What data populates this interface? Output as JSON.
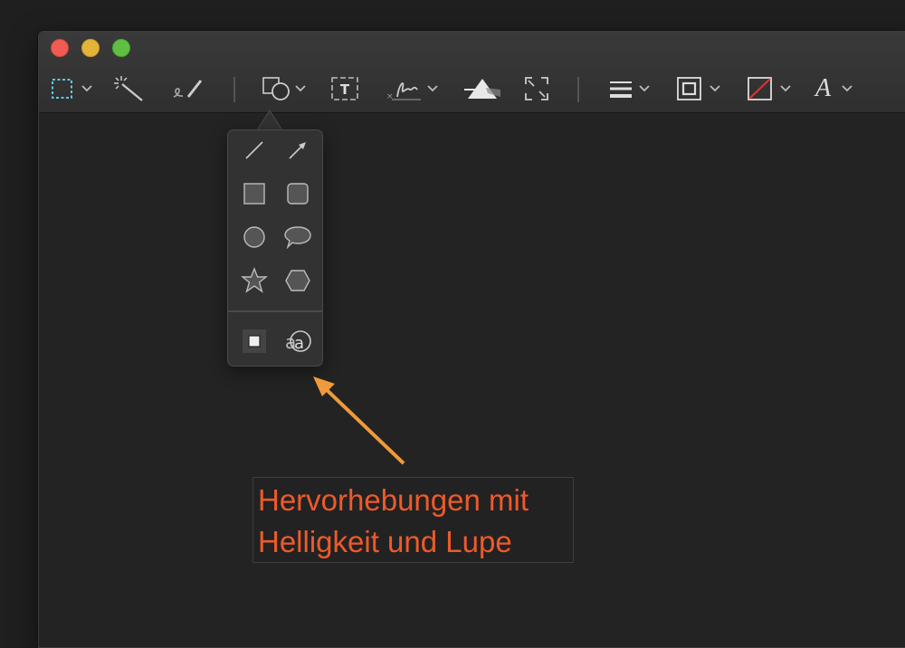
{
  "window": {
    "traffic_lights": [
      "close",
      "minimize",
      "zoom"
    ]
  },
  "toolbar": {
    "tools": [
      {
        "name": "selection-tools",
        "icon": "dashed-rect-icon",
        "has_menu": true
      },
      {
        "name": "instant-alpha",
        "icon": "magic-wand-icon",
        "has_menu": false
      },
      {
        "name": "sketch",
        "icon": "pen-scribble-icon",
        "has_menu": false
      },
      {
        "name": "shapes",
        "icon": "shapes-icon",
        "has_menu": true,
        "active": true
      },
      {
        "name": "text",
        "icon": "text-box-icon",
        "has_menu": false
      },
      {
        "name": "sign",
        "icon": "signature-icon",
        "has_menu": true
      },
      {
        "name": "adjust-color",
        "icon": "prism-icon",
        "has_menu": false
      },
      {
        "name": "adjust-size",
        "icon": "resize-icon",
        "has_menu": false
      },
      {
        "name": "shape-style",
        "icon": "lines-icon",
        "has_menu": true
      },
      {
        "name": "border-color",
        "icon": "border-icon",
        "has_menu": true
      },
      {
        "name": "fill-color",
        "icon": "fill-none-icon",
        "has_menu": true
      },
      {
        "name": "text-style",
        "icon": "font-a-icon",
        "label": "A",
        "has_menu": true
      }
    ]
  },
  "shapes_menu": {
    "items": [
      "line",
      "arrow",
      "rectangle",
      "rounded-rectangle",
      "oval",
      "speech-bubble",
      "star",
      "polygon"
    ],
    "highlight_items": [
      "highlight",
      "loupe"
    ]
  },
  "annotation": {
    "line1": "Hervorhebungen mit",
    "line2": "Helligkeit und Lupe",
    "color": "#ee5a2a",
    "arrow_color": "#f09a3a"
  }
}
